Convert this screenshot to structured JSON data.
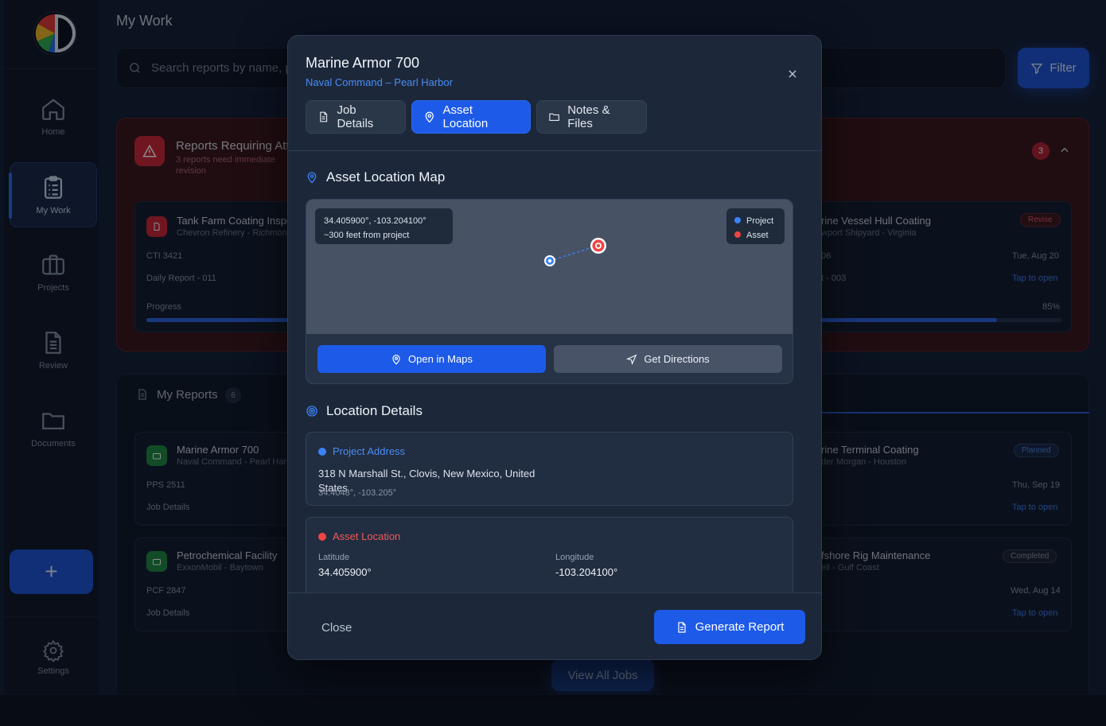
{
  "sidebar": {
    "items": [
      {
        "label": "Home",
        "icon": "home-icon"
      },
      {
        "label": "My Work",
        "icon": "clipboard-icon"
      },
      {
        "label": "Projects",
        "icon": "briefcase-icon"
      },
      {
        "label": "Review",
        "icon": "document-icon"
      },
      {
        "label": "Documents",
        "icon": "folder-icon"
      }
    ],
    "add_label": "+",
    "settings_label": "Settings"
  },
  "page": {
    "title": "My Work"
  },
  "search": {
    "placeholder": "Search reports by name, pr"
  },
  "filter": {
    "label": "Filter"
  },
  "requiring": {
    "title": "Reports Requiring Att",
    "subtitle": "3 reports need immediate revision",
    "count": "3",
    "cards": [
      {
        "title": "Tank Farm Coating Inspe",
        "sub": "Chevron Refinery - Richmon",
        "code": "CTI 3421",
        "report": "Daily Report - 011",
        "progress_label": "Progress",
        "progress": 0.85
      },
      {
        "title": "rine Vessel Hull Coating",
        "sub": "wport Shipyard - Virginia",
        "badge": "Revise",
        "code": "06",
        "date": "Tue, Aug 20",
        "report": "t - 003",
        "tap": "Tap to open",
        "pct": "85%",
        "progress": 0.85
      }
    ]
  },
  "reports": {
    "title": "My Reports",
    "count": "6",
    "cards": [
      {
        "title": "Marine Armor 700",
        "sub": "Naval Command - Pearl Har",
        "code": "PPS 2511",
        "link": "Job Details"
      },
      {
        "title": "rine Terminal Coating",
        "sub": "der Morgan - Houston",
        "badge": "Planned",
        "date": "Thu, Sep 19",
        "tap": "Tap to open"
      },
      {
        "title": "Petrochemical Facility",
        "sub": "ExxonMobil - Baytown",
        "code": "PCF 2847",
        "link": "Job Details"
      },
      {
        "title": "fshore Rig Maintenance",
        "sub": "ell - Gulf Coast",
        "badge": "Completed",
        "date": "Wed, Aug 14",
        "tap": "Tap to open"
      }
    ],
    "view_all": "View All Jobs"
  },
  "modal": {
    "title": "Marine Armor 700",
    "subtitle": "Naval Command – Pearl Harbor",
    "tabs": [
      {
        "label": "Job Details",
        "icon": "document-icon"
      },
      {
        "label": "Asset Location",
        "icon": "map-pin-icon"
      },
      {
        "label": "Notes & Files",
        "icon": "folder-icon"
      }
    ],
    "active_tab": "Asset Location",
    "map_section": {
      "title": "Asset Location Map",
      "coords": "34.405900°, -103.204100°",
      "distance": "~300 feet from project",
      "legend": [
        {
          "label": "Project",
          "color": "#3b82f6"
        },
        {
          "label": "Asset",
          "color": "#ef4444"
        }
      ],
      "open_maps": "Open in Maps",
      "directions": "Get Directions"
    },
    "details_section": {
      "title": "Location Details",
      "project_label": "Project Address",
      "project_address": "318 N Marshall St., Clovis, New Mexico, United States",
      "project_coords": "34.4048°, -103.205°",
      "asset_label": "Asset Location",
      "latitude_label": "Latitude",
      "latitude": "34.405900°",
      "longitude_label": "Longitude",
      "longitude": "-103.204100°"
    },
    "close": "Close",
    "generate": "Generate Report"
  },
  "colors": {
    "accent": "#1d5ae8",
    "danger": "#ef4444",
    "project": "#3b82f6"
  }
}
